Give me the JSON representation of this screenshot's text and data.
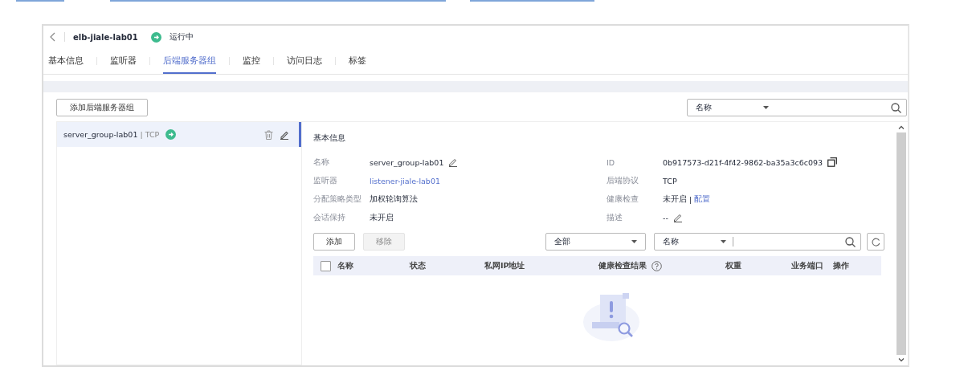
{
  "header": {
    "title": "elb-jiale-lab01",
    "status": "运行中",
    "running": true
  },
  "tabs": [
    {
      "label": "基本信息",
      "selected": false
    },
    {
      "label": "监听器",
      "selected": false
    },
    {
      "label": "后端服务器组",
      "selected": true
    },
    {
      "label": "监控",
      "selected": false
    },
    {
      "label": "访问日志",
      "selected": false
    },
    {
      "label": "标签",
      "selected": false
    }
  ],
  "add_group_button": "添加后端服务器组",
  "group_search": {
    "filter": "名称"
  },
  "groups": [
    {
      "name": "server_group-lab01",
      "separator": "|",
      "protocol": "TCP",
      "selected": true
    }
  ],
  "detail": {
    "section_title": "基本信息",
    "fields": [
      {
        "label": "名称",
        "value": "server_group-lab01",
        "kind": "editable"
      },
      {
        "label": "ID",
        "value": "0b917573-d21f-4f42-9862-ba35a3c6c093",
        "kind": "copyable"
      },
      {
        "label": "监听器",
        "value": "listener-jiale-lab01",
        "kind": "link"
      },
      {
        "label": "后端协议",
        "value": "TCP",
        "kind": "text"
      },
      {
        "label": "分配策略类型",
        "value": "加权轮询算法",
        "kind": "text"
      },
      {
        "label": "健康检查",
        "value": "未开启",
        "separator": "|",
        "link": "配置",
        "kind": "text_link"
      },
      {
        "label": "会话保持",
        "value": "未开启",
        "kind": "text"
      },
      {
        "label": "描述",
        "value": "--",
        "kind": "editable"
      }
    ]
  },
  "toolbar": {
    "add_button": {
      "label": "添加",
      "disabled": false
    },
    "remove_button": {
      "label": "移除",
      "disabled": true
    },
    "status_filter": "全部",
    "name_filter": "名称"
  },
  "table": {
    "select_all": {
      "checked": false
    },
    "columns": [
      {
        "label": "名称",
        "help": false
      },
      {
        "label": "状态",
        "help": false
      },
      {
        "label": "私网IP地址",
        "help": false
      },
      {
        "label": "健康检查结果",
        "help": true
      },
      {
        "label": "权重",
        "help": false
      },
      {
        "label": "业务端口",
        "help": false
      },
      {
        "label": "操作",
        "help": false
      }
    ]
  }
}
